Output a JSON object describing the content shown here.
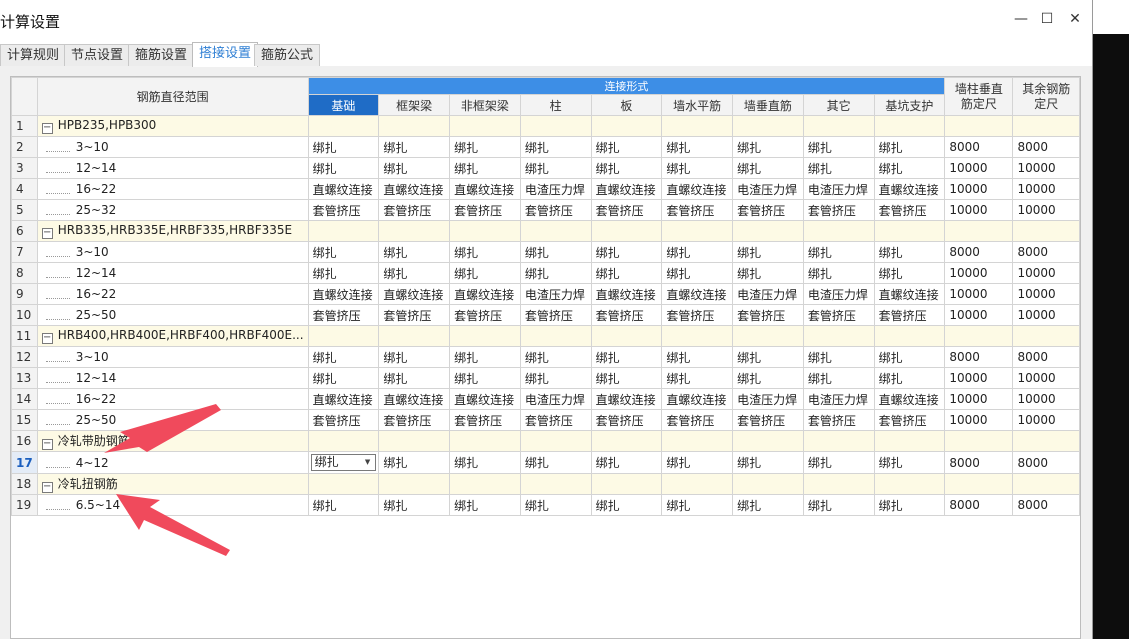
{
  "window": {
    "title": "计算设置",
    "minimize_icon": "minimize-icon",
    "maximize_icon": "maximize-icon",
    "close_icon": "close-icon",
    "minimize": "—",
    "maximize": "☐",
    "close": "✕"
  },
  "tabs": [
    {
      "label": "计算规则"
    },
    {
      "label": "节点设置"
    },
    {
      "label": "箍筋设置"
    },
    {
      "label": "搭接设置",
      "active": true
    },
    {
      "label": "箍筋公式"
    }
  ],
  "table": {
    "header": {
      "range_col": "钢筋直径范围",
      "group_label": "连接形式",
      "sub_cols": [
        "基础",
        "框架梁",
        "非框架梁",
        "柱",
        "板",
        "墙水平筋",
        "墙垂直筋",
        "其它",
        "基坑支护"
      ],
      "col_wall": "墙柱垂直筋定尺",
      "col_other": "其余钢筋定尺"
    },
    "rows": [
      {
        "n": "1",
        "type": "group",
        "name": "HPB235,HPB300"
      },
      {
        "n": "2",
        "type": "child",
        "name": "3~10",
        "vals": [
          "绑扎",
          "绑扎",
          "绑扎",
          "绑扎",
          "绑扎",
          "绑扎",
          "绑扎",
          "绑扎",
          "绑扎",
          "8000",
          "8000"
        ]
      },
      {
        "n": "3",
        "type": "child",
        "name": "12~14",
        "vals": [
          "绑扎",
          "绑扎",
          "绑扎",
          "绑扎",
          "绑扎",
          "绑扎",
          "绑扎",
          "绑扎",
          "绑扎",
          "10000",
          "10000"
        ]
      },
      {
        "n": "4",
        "type": "child",
        "name": "16~22",
        "vals": [
          "直螺纹连接",
          "直螺纹连接",
          "直螺纹连接",
          "电渣压力焊",
          "直螺纹连接",
          "直螺纹连接",
          "电渣压力焊",
          "电渣压力焊",
          "直螺纹连接",
          "10000",
          "10000"
        ]
      },
      {
        "n": "5",
        "type": "child",
        "name": "25~32",
        "vals": [
          "套管挤压",
          "套管挤压",
          "套管挤压",
          "套管挤压",
          "套管挤压",
          "套管挤压",
          "套管挤压",
          "套管挤压",
          "套管挤压",
          "10000",
          "10000"
        ]
      },
      {
        "n": "6",
        "type": "group",
        "name": "HRB335,HRB335E,HRBF335,HRBF335E"
      },
      {
        "n": "7",
        "type": "child",
        "name": "3~10",
        "vals": [
          "绑扎",
          "绑扎",
          "绑扎",
          "绑扎",
          "绑扎",
          "绑扎",
          "绑扎",
          "绑扎",
          "绑扎",
          "8000",
          "8000"
        ]
      },
      {
        "n": "8",
        "type": "child",
        "name": "12~14",
        "vals": [
          "绑扎",
          "绑扎",
          "绑扎",
          "绑扎",
          "绑扎",
          "绑扎",
          "绑扎",
          "绑扎",
          "绑扎",
          "10000",
          "10000"
        ]
      },
      {
        "n": "9",
        "type": "child",
        "name": "16~22",
        "vals": [
          "直螺纹连接",
          "直螺纹连接",
          "直螺纹连接",
          "电渣压力焊",
          "直螺纹连接",
          "直螺纹连接",
          "电渣压力焊",
          "电渣压力焊",
          "直螺纹连接",
          "10000",
          "10000"
        ]
      },
      {
        "n": "10",
        "type": "child",
        "name": "25~50",
        "vals": [
          "套管挤压",
          "套管挤压",
          "套管挤压",
          "套管挤压",
          "套管挤压",
          "套管挤压",
          "套管挤压",
          "套管挤压",
          "套管挤压",
          "10000",
          "10000"
        ]
      },
      {
        "n": "11",
        "type": "group",
        "name": "HRB400,HRB400E,HRBF400,HRBF400E..."
      },
      {
        "n": "12",
        "type": "child",
        "name": "3~10",
        "vals": [
          "绑扎",
          "绑扎",
          "绑扎",
          "绑扎",
          "绑扎",
          "绑扎",
          "绑扎",
          "绑扎",
          "绑扎",
          "8000",
          "8000"
        ]
      },
      {
        "n": "13",
        "type": "child",
        "name": "12~14",
        "vals": [
          "绑扎",
          "绑扎",
          "绑扎",
          "绑扎",
          "绑扎",
          "绑扎",
          "绑扎",
          "绑扎",
          "绑扎",
          "10000",
          "10000"
        ]
      },
      {
        "n": "14",
        "type": "child",
        "name": "16~22",
        "vals": [
          "直螺纹连接",
          "直螺纹连接",
          "直螺纹连接",
          "电渣压力焊",
          "直螺纹连接",
          "直螺纹连接",
          "电渣压力焊",
          "电渣压力焊",
          "直螺纹连接",
          "10000",
          "10000"
        ]
      },
      {
        "n": "15",
        "type": "child",
        "name": "25~50",
        "vals": [
          "套管挤压",
          "套管挤压",
          "套管挤压",
          "套管挤压",
          "套管挤压",
          "套管挤压",
          "套管挤压",
          "套管挤压",
          "套管挤压",
          "10000",
          "10000"
        ]
      },
      {
        "n": "16",
        "type": "group",
        "name": "冷轧带肋钢筋"
      },
      {
        "n": "17",
        "type": "child",
        "current": true,
        "name": "4~12",
        "vals": [
          "绑扎",
          "绑扎",
          "绑扎",
          "绑扎",
          "绑扎",
          "绑扎",
          "绑扎",
          "绑扎",
          "绑扎",
          "8000",
          "8000"
        ]
      },
      {
        "n": "18",
        "type": "group",
        "name": "冷轧扭钢筋"
      },
      {
        "n": "19",
        "type": "child",
        "name": "6.5~14",
        "vals": [
          "绑扎",
          "绑扎",
          "绑扎",
          "绑扎",
          "绑扎",
          "绑扎",
          "绑扎",
          "绑扎",
          "绑扎",
          "8000",
          "8000"
        ]
      }
    ]
  },
  "colors": {
    "header_blue": "#3d8ee6",
    "group_row": "#fdfae5",
    "annotation_arrow": "#f04a5c",
    "active_tab_text": "#2f7fd4"
  }
}
